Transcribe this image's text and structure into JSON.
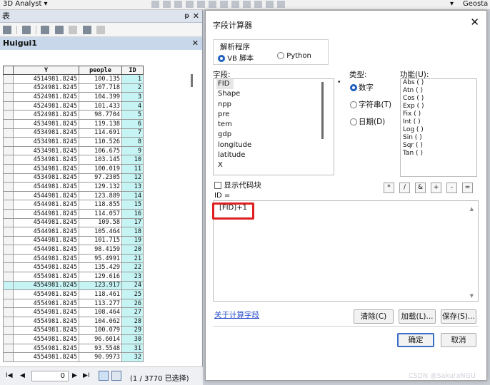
{
  "topbar": {
    "analyst": "3D Analyst ▾",
    "geostat": "Geosta",
    "arrow": "▾"
  },
  "table_window": {
    "title": "表",
    "pin": "ᵽ",
    "close": "✕",
    "tab_name": "Huigui1",
    "tab_close": "✕",
    "columns": [
      "Y",
      "people",
      "ID"
    ],
    "rows": [
      {
        "y": "4514981.8245",
        "people": "100.135",
        "id": "1"
      },
      {
        "y": "4524981.8245",
        "people": "107.718",
        "id": "2"
      },
      {
        "y": "4524981.8245",
        "people": "104.399",
        "id": "3"
      },
      {
        "y": "4524981.8245",
        "people": "101.433",
        "id": "4"
      },
      {
        "y": "4524981.8245",
        "people": "98.7704",
        "id": "5"
      },
      {
        "y": "4534981.8245",
        "people": "119.138",
        "id": "6"
      },
      {
        "y": "4534981.8245",
        "people": "114.691",
        "id": "7"
      },
      {
        "y": "4534981.8245",
        "people": "110.526",
        "id": "8"
      },
      {
        "y": "4534981.8245",
        "people": "106.675",
        "id": "9"
      },
      {
        "y": "4534981.8245",
        "people": "103.145",
        "id": "10"
      },
      {
        "y": "4534981.8245",
        "people": "100.019",
        "id": "11"
      },
      {
        "y": "4534981.8245",
        "people": "97.2305",
        "id": "12"
      },
      {
        "y": "4544981.8245",
        "people": "129.132",
        "id": "13"
      },
      {
        "y": "4544981.8245",
        "people": "123.889",
        "id": "14"
      },
      {
        "y": "4544981.8245",
        "people": "118.855",
        "id": "15"
      },
      {
        "y": "4544981.8245",
        "people": "114.057",
        "id": "16"
      },
      {
        "y": "4544981.8245",
        "people": "109.58",
        "id": "17"
      },
      {
        "y": "4544981.8245",
        "people": "105.464",
        "id": "18"
      },
      {
        "y": "4544981.8245",
        "people": "101.715",
        "id": "19"
      },
      {
        "y": "4544981.8245",
        "people": "98.4159",
        "id": "20"
      },
      {
        "y": "4544981.8245",
        "people": "95.4991",
        "id": "21"
      },
      {
        "y": "4554981.8245",
        "people": "135.429",
        "id": "22"
      },
      {
        "y": "4554981.8245",
        "people": "129.616",
        "id": "23"
      },
      {
        "y": "4554981.8245",
        "people": "123.917",
        "id": "24"
      },
      {
        "y": "4554981.8245",
        "people": "118.461",
        "id": "25"
      },
      {
        "y": "4554981.8245",
        "people": "113.277",
        "id": "26"
      },
      {
        "y": "4554981.8245",
        "people": "108.464",
        "id": "27"
      },
      {
        "y": "4554981.8245",
        "people": "104.062",
        "id": "28"
      },
      {
        "y": "4554981.8245",
        "people": "100.079",
        "id": "29"
      },
      {
        "y": "4554981.8245",
        "people": "96.6014",
        "id": "30"
      },
      {
        "y": "4554981.8245",
        "people": "93.5548",
        "id": "31"
      },
      {
        "y": "4554981.8245",
        "people": "90.9973",
        "id": "32"
      }
    ],
    "highlight_row_id": "24",
    "nav": {
      "first": "I◀",
      "prev": "◀",
      "position": "0",
      "next": "▶",
      "last": "▶I",
      "count": "(1 / 3770 已选择)"
    }
  },
  "dialog": {
    "title": "字段计算器",
    "close": "✕",
    "parser_label": "解析程序",
    "parser_vb": "VB 脚本",
    "parser_python": "Python",
    "fields_label": "字段:",
    "fields": [
      "FID",
      "Shape",
      "npp",
      "pre",
      "tem",
      "gdp",
      "longitude",
      "latitude",
      "X"
    ],
    "type_label": "类型:",
    "types": [
      "数字",
      "字符串(T)",
      "日期(D)"
    ],
    "func_label": "功能(U):",
    "functions": [
      "Abs ( )",
      "Atn ( )",
      "Cos ( )",
      "Exp ( )",
      "Fix ( )",
      "Int ( )",
      "Log ( )",
      "Sin ( )",
      "Sqr ( )",
      "Tan ( )"
    ],
    "show_codeblock": "显示代码块",
    "operators": [
      "*",
      "/",
      "&",
      "+",
      "-",
      "="
    ],
    "expr_label": "ID =",
    "expression": "[FID]+1",
    "about_link": "关于计算字段",
    "btn_clear": "清除(C)",
    "btn_load": "加载(L)...",
    "btn_save": "保存(S)...",
    "btn_ok": "确定",
    "btn_cancel": "取消"
  },
  "watermark": "CSDN @SakuraNGU",
  "colors": {
    "accent_red": "#e02020",
    "highlight_cyan": "#c6f3f3",
    "link_blue": "#1f44c9"
  }
}
